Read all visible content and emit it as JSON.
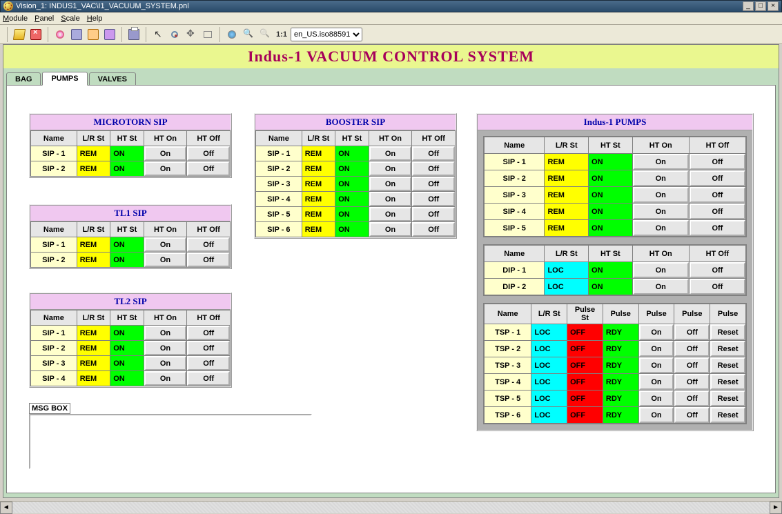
{
  "window": {
    "title": "Vision_1: INDUS1_VAC\\I1_VACUUM_SYSTEM.pnl"
  },
  "menu": {
    "items": [
      "Module",
      "Panel",
      "Scale",
      "Help"
    ]
  },
  "toolbar": {
    "ratio": "1:1",
    "encoding_options": [
      "en_US.iso88591"
    ],
    "encoding_selected": "en_US.iso88591"
  },
  "heading": "Indus-1 VACUUM CONTROL SYSTEM",
  "tabs": [
    "BAG",
    "PUMPS",
    "VALVES"
  ],
  "selected_tab": "PUMPS",
  "msgbox_label": "MSG BOX",
  "columns_std": [
    "Name",
    "L/R St",
    "HT St",
    "HT On",
    "HT Off"
  ],
  "columns_tsp": [
    "Name",
    "L/R St",
    "Pulse St",
    "Pulse",
    "Pulse",
    "Pulse",
    "Pulse"
  ],
  "btn_labels": {
    "on": "On",
    "off": "Off",
    "reset": "Reset"
  },
  "groups": {
    "microtorn": {
      "title": "MICROTORN SIP",
      "rows": [
        {
          "name": "SIP - 1",
          "lr": "REM",
          "ht": "ON"
        },
        {
          "name": "SIP - 2",
          "lr": "REM",
          "ht": "ON"
        }
      ]
    },
    "tl1": {
      "title": "TL1 SIP",
      "rows": [
        {
          "name": "SIP - 1",
          "lr": "REM",
          "ht": "ON"
        },
        {
          "name": "SIP - 2",
          "lr": "REM",
          "ht": "ON"
        }
      ]
    },
    "tl2": {
      "title": "TL2 SIP",
      "rows": [
        {
          "name": "SIP - 1",
          "lr": "REM",
          "ht": "ON"
        },
        {
          "name": "SIP - 2",
          "lr": "REM",
          "ht": "ON"
        },
        {
          "name": "SIP - 3",
          "lr": "REM",
          "ht": "ON"
        },
        {
          "name": "SIP - 4",
          "lr": "REM",
          "ht": "ON"
        }
      ]
    },
    "booster": {
      "title": "BOOSTER SIP",
      "rows": [
        {
          "name": "SIP - 1",
          "lr": "REM",
          "ht": "ON"
        },
        {
          "name": "SIP - 2",
          "lr": "REM",
          "ht": "ON"
        },
        {
          "name": "SIP - 3",
          "lr": "REM",
          "ht": "ON"
        },
        {
          "name": "SIP - 4",
          "lr": "REM",
          "ht": "ON"
        },
        {
          "name": "SIP - 5",
          "lr": "REM",
          "ht": "ON"
        },
        {
          "name": "SIP - 6",
          "lr": "REM",
          "ht": "ON"
        }
      ]
    },
    "indus": {
      "title": "Indus-1 PUMPS",
      "sip_rows": [
        {
          "name": "SIP - 1",
          "lr": "REM",
          "ht": "ON"
        },
        {
          "name": "SIP - 2",
          "lr": "REM",
          "ht": "ON"
        },
        {
          "name": "SIP - 3",
          "lr": "REM",
          "ht": "ON"
        },
        {
          "name": "SIP - 4",
          "lr": "REM",
          "ht": "ON"
        },
        {
          "name": "SIP - 5",
          "lr": "REM",
          "ht": "ON"
        }
      ],
      "dip_rows": [
        {
          "name": "DIP - 1",
          "lr": "LOC",
          "ht": "ON"
        },
        {
          "name": "DIP - 2",
          "lr": "LOC",
          "ht": "ON"
        }
      ],
      "tsp_rows": [
        {
          "name": "TSP - 1",
          "lr": "LOC",
          "ps": "OFF",
          "pulse": "RDY"
        },
        {
          "name": "TSP - 2",
          "lr": "LOC",
          "ps": "OFF",
          "pulse": "RDY"
        },
        {
          "name": "TSP - 3",
          "lr": "LOC",
          "ps": "OFF",
          "pulse": "RDY"
        },
        {
          "name": "TSP - 4",
          "lr": "LOC",
          "ps": "OFF",
          "pulse": "RDY"
        },
        {
          "name": "TSP - 5",
          "lr": "LOC",
          "ps": "OFF",
          "pulse": "RDY"
        },
        {
          "name": "TSP - 6",
          "lr": "LOC",
          "ps": "OFF",
          "pulse": "RDY"
        }
      ]
    }
  }
}
